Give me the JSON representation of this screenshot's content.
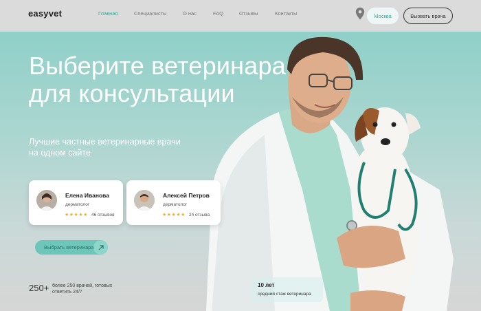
{
  "header": {
    "logo": "easyvet",
    "nav": [
      {
        "label": "Главная",
        "active": true
      },
      {
        "label": "Специалисты",
        "active": false
      },
      {
        "label": "О нас",
        "active": false
      },
      {
        "label": "FAQ",
        "active": false
      },
      {
        "label": "Отзывы",
        "active": false
      },
      {
        "label": "Контакты",
        "active": false
      }
    ],
    "city": "Москва",
    "call_button": "Вызвать врача",
    "location_icon": "map-pin-icon"
  },
  "hero": {
    "title_line1": "Выберите ветеринара",
    "title_line2": "для консультации",
    "subtitle": "Лучшие частные ветеринарные врачи на одном сайте",
    "choose_button": "Выбрать ветеринара",
    "stat_number": "250+",
    "stat_text": "более 250 врачей, готовых ответить 24/7",
    "experience_years": "10 лет",
    "experience_label": "средний стаж ветеринара"
  },
  "doctors": [
    {
      "name": "Елена Иванова",
      "role": "дерматолог",
      "stars": "★★★★★",
      "rating": 5,
      "reviews": "46 отзывов"
    },
    {
      "name": "Алексей Петров",
      "role": "дерматолог",
      "stars": "★★★★★",
      "rating": 5,
      "reviews": "24 отзыва"
    }
  ],
  "colors": {
    "accent": "#3aa99a",
    "hero_top": "#8fd0c8",
    "star": "#f2b01e"
  }
}
